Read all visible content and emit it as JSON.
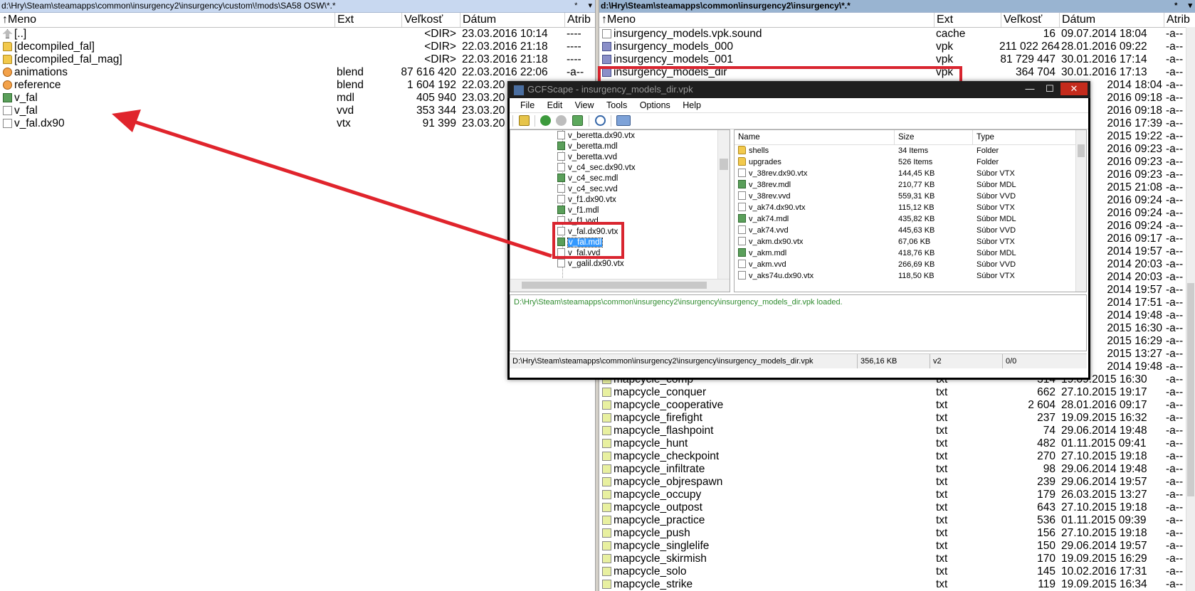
{
  "left": {
    "path": "d:\\Hry\\Steam\\steamapps\\common\\insurgency2\\insurgency\\custom\\!mods\\SA58 OSW\\*.*",
    "path_btns": [
      "*",
      "▾"
    ],
    "headers": {
      "name": "↑Meno",
      "ext": "Ext",
      "size": "Veľkosť",
      "date": "Dátum",
      "attr": "Atrib"
    },
    "rows": [
      {
        "icon": "up",
        "name": "[..]",
        "ext": "",
        "size": "<DIR>",
        "date": "23.03.2016 10:14",
        "attr": "----"
      },
      {
        "icon": "folder",
        "name": "[decompiled_fal]",
        "ext": "",
        "size": "<DIR>",
        "date": "22.03.2016 21:18",
        "attr": "----"
      },
      {
        "icon": "folder",
        "name": "[decompiled_fal_mag]",
        "ext": "",
        "size": "<DIR>",
        "date": "22.03.2016 21:18",
        "attr": "----"
      },
      {
        "icon": "blend",
        "name": "animations",
        "ext": "blend",
        "size": "87 616 420",
        "date": "22.03.2016 22:06",
        "attr": "-a--"
      },
      {
        "icon": "blend",
        "name": "reference",
        "ext": "blend",
        "size": "1 604 192",
        "date": "22.03.20",
        "attr": ""
      },
      {
        "icon": "mdl",
        "name": "v_fal",
        "ext": "mdl",
        "size": "405 940",
        "date": "23.03.20",
        "attr": ""
      },
      {
        "icon": "file",
        "name": "v_fal",
        "ext": "vvd",
        "size": "353 344",
        "date": "23.03.20",
        "attr": ""
      },
      {
        "icon": "file",
        "name": "v_fal.dx90",
        "ext": "vtx",
        "size": "91 399",
        "date": "23.03.20",
        "attr": ""
      }
    ]
  },
  "right": {
    "path": "d:\\Hry\\Steam\\steamapps\\common\\insurgency2\\insurgency\\*.*",
    "path_btns": [
      "*",
      "▾"
    ],
    "headers": {
      "name": "↑Meno",
      "ext": "Ext",
      "size": "Veľkosť",
      "date": "Dátum",
      "attr": "Atrib"
    },
    "top_rows": [
      {
        "icon": "file",
        "name": "insurgency_models.vpk.sound",
        "ext": "cache",
        "size": "16",
        "date": "09.07.2014 18:04",
        "attr": "-a--"
      },
      {
        "icon": "vpk",
        "name": "insurgency_models_000",
        "ext": "vpk",
        "size": "211 022 264",
        "date": "28.01.2016 09:22",
        "attr": "-a--"
      },
      {
        "icon": "vpk",
        "name": "insurgency_models_001",
        "ext": "vpk",
        "size": "81 729 447",
        "date": "30.01.2016 17:14",
        "attr": "-a--"
      },
      {
        "icon": "vpk",
        "name": "insurgency_models_dir",
        "ext": "vpk",
        "size": "364 704",
        "date": "30.01.2016 17:13",
        "attr": "-a--"
      }
    ],
    "hidden_rows": [
      {
        "date": "2014 18:04",
        "attr": "-a--"
      },
      {
        "date": "2016 09:18",
        "attr": "-a--"
      },
      {
        "date": "2016 09:18",
        "attr": "-a--"
      },
      {
        "date": "2016 17:39",
        "attr": "-a--"
      },
      {
        "date": "2015 19:22",
        "attr": "-a--"
      },
      {
        "date": "2016 09:23",
        "attr": "-a--"
      },
      {
        "date": "2016 09:23",
        "attr": "-a--"
      },
      {
        "date": "2016 09:23",
        "attr": "-a--"
      },
      {
        "date": "2015 21:08",
        "attr": "-a--"
      },
      {
        "date": "2016 09:24",
        "attr": "-a--"
      },
      {
        "date": "2016 09:24",
        "attr": "-a--"
      },
      {
        "date": "2016 09:24",
        "attr": "-a--"
      },
      {
        "date": "2016 09:17",
        "attr": "-a--"
      },
      {
        "date": "2014 19:57",
        "attr": "-a--"
      },
      {
        "date": "2014 20:03",
        "attr": "-a--"
      },
      {
        "date": "2014 20:03",
        "attr": "-a--"
      },
      {
        "date": "2014 19:57",
        "attr": "-a--"
      },
      {
        "date": "2014 17:51",
        "attr": "-a--"
      },
      {
        "date": "2014 19:48",
        "attr": "-a--"
      },
      {
        "date": "2015 16:30",
        "attr": "-a--"
      },
      {
        "date": "2015 16:29",
        "attr": "-a--"
      },
      {
        "date": "2015 13:27",
        "attr": "-a--"
      },
      {
        "date": "2014 19:48",
        "attr": "-a--"
      }
    ],
    "bottom_rows": [
      {
        "icon": "txt",
        "name": "mapcycle_comp",
        "ext": "txt",
        "size": "314",
        "date": "19.09.2015 16:30",
        "attr": "-a--"
      },
      {
        "icon": "txt",
        "name": "mapcycle_conquer",
        "ext": "txt",
        "size": "662",
        "date": "27.10.2015 19:17",
        "attr": "-a--"
      },
      {
        "icon": "txt",
        "name": "mapcycle_cooperative",
        "ext": "txt",
        "size": "2 604",
        "date": "28.01.2016 09:17",
        "attr": "-a--"
      },
      {
        "icon": "txt",
        "name": "mapcycle_firefight",
        "ext": "txt",
        "size": "237",
        "date": "19.09.2015 16:32",
        "attr": "-a--"
      },
      {
        "icon": "txt",
        "name": "mapcycle_flashpoint",
        "ext": "txt",
        "size": "74",
        "date": "29.06.2014 19:48",
        "attr": "-a--"
      },
      {
        "icon": "txt",
        "name": "mapcycle_hunt",
        "ext": "txt",
        "size": "482",
        "date": "01.11.2015 09:41",
        "attr": "-a--"
      },
      {
        "icon": "txt",
        "name": "mapcycle_checkpoint",
        "ext": "txt",
        "size": "270",
        "date": "27.10.2015 19:18",
        "attr": "-a--"
      },
      {
        "icon": "txt",
        "name": "mapcycle_infiltrate",
        "ext": "txt",
        "size": "98",
        "date": "29.06.2014 19:48",
        "attr": "-a--"
      },
      {
        "icon": "txt",
        "name": "mapcycle_objrespawn",
        "ext": "txt",
        "size": "239",
        "date": "29.06.2014 19:57",
        "attr": "-a--"
      },
      {
        "icon": "txt",
        "name": "mapcycle_occupy",
        "ext": "txt",
        "size": "179",
        "date": "26.03.2015 13:27",
        "attr": "-a--"
      },
      {
        "icon": "txt",
        "name": "mapcycle_outpost",
        "ext": "txt",
        "size": "643",
        "date": "27.10.2015 19:18",
        "attr": "-a--"
      },
      {
        "icon": "txt",
        "name": "mapcycle_practice",
        "ext": "txt",
        "size": "536",
        "date": "01.11.2015 09:39",
        "attr": "-a--"
      },
      {
        "icon": "txt",
        "name": "mapcycle_push",
        "ext": "txt",
        "size": "156",
        "date": "27.10.2015 19:18",
        "attr": "-a--"
      },
      {
        "icon": "txt",
        "name": "mapcycle_singlelife",
        "ext": "txt",
        "size": "150",
        "date": "29.06.2014 19:57",
        "attr": "-a--"
      },
      {
        "icon": "txt",
        "name": "mapcycle_skirmish",
        "ext": "txt",
        "size": "170",
        "date": "19.09.2015 16:29",
        "attr": "-a--"
      },
      {
        "icon": "txt",
        "name": "mapcycle_solo",
        "ext": "txt",
        "size": "145",
        "date": "10.02.2016 17:31",
        "attr": "-a--"
      },
      {
        "icon": "txt",
        "name": "mapcycle_strike",
        "ext": "txt",
        "size": "119",
        "date": "19.09.2015 16:34",
        "attr": "-a--"
      }
    ]
  },
  "gcf": {
    "title": "GCFScape - insurgency_models_dir.vpk",
    "window_btns": {
      "min": "—",
      "max": "☐",
      "close": "✕"
    },
    "menu": [
      "File",
      "Edit",
      "View",
      "Tools",
      "Options",
      "Help"
    ],
    "tree": [
      {
        "icon": "file",
        "name": "v_beretta.dx90.vtx"
      },
      {
        "icon": "mdl",
        "name": "v_beretta.mdl"
      },
      {
        "icon": "file",
        "name": "v_beretta.vvd"
      },
      {
        "icon": "file",
        "name": "v_c4_sec.dx90.vtx"
      },
      {
        "icon": "mdl",
        "name": "v_c4_sec.mdl"
      },
      {
        "icon": "file",
        "name": "v_c4_sec.vvd"
      },
      {
        "icon": "file",
        "name": "v_f1.dx90.vtx"
      },
      {
        "icon": "mdl",
        "name": "v_f1.mdl"
      },
      {
        "icon": "file",
        "name": "v_f1.vvd"
      },
      {
        "icon": "file",
        "name": "v_fal.dx90.vtx"
      },
      {
        "icon": "mdl",
        "name": "v_fal.mdl",
        "selected": true
      },
      {
        "icon": "file",
        "name": "v_fal.vvd"
      },
      {
        "icon": "file",
        "name": "v_galil.dx90.vtx"
      }
    ],
    "list_headers": {
      "name": "Name",
      "size": "Size",
      "type": "Type"
    },
    "list": [
      {
        "icon": "folder",
        "name": "shells",
        "size": "34 Items",
        "type": "Folder"
      },
      {
        "icon": "folder",
        "name": "upgrades",
        "size": "526 Items",
        "type": "Folder"
      },
      {
        "icon": "file",
        "name": "v_38rev.dx90.vtx",
        "size": "144,45 KB",
        "type": "Súbor VTX"
      },
      {
        "icon": "mdl",
        "name": "v_38rev.mdl",
        "size": "210,77 KB",
        "type": "Súbor MDL"
      },
      {
        "icon": "file",
        "name": "v_38rev.vvd",
        "size": "559,31 KB",
        "type": "Súbor VVD"
      },
      {
        "icon": "file",
        "name": "v_ak74.dx90.vtx",
        "size": "115,12 KB",
        "type": "Súbor VTX"
      },
      {
        "icon": "mdl",
        "name": "v_ak74.mdl",
        "size": "435,82 KB",
        "type": "Súbor MDL"
      },
      {
        "icon": "file",
        "name": "v_ak74.vvd",
        "size": "445,63 KB",
        "type": "Súbor VVD"
      },
      {
        "icon": "file",
        "name": "v_akm.dx90.vtx",
        "size": "67,06 KB",
        "type": "Súbor VTX"
      },
      {
        "icon": "mdl",
        "name": "v_akm.mdl",
        "size": "418,76 KB",
        "type": "Súbor MDL"
      },
      {
        "icon": "file",
        "name": "v_akm.vvd",
        "size": "266,69 KB",
        "type": "Súbor VVD"
      },
      {
        "icon": "file",
        "name": "v_aks74u.dx90.vtx",
        "size": "118,50 KB",
        "type": "Súbor VTX"
      }
    ],
    "log": "D:\\Hry\\Steam\\steamapps\\common\\insurgency2\\insurgency\\insurgency_models_dir.vpk loaded.",
    "status": {
      "path": "D:\\Hry\\Steam\\steamapps\\common\\insurgency2\\insurgency\\insurgency_models_dir.vpk",
      "size": "356,16 KB",
      "version": "v2",
      "count": "0/0"
    }
  },
  "colors": {
    "highlight": "#d9252f",
    "arrow": "#e0242c",
    "selection": "#3399ff",
    "log_text": "#2e8b2e"
  }
}
